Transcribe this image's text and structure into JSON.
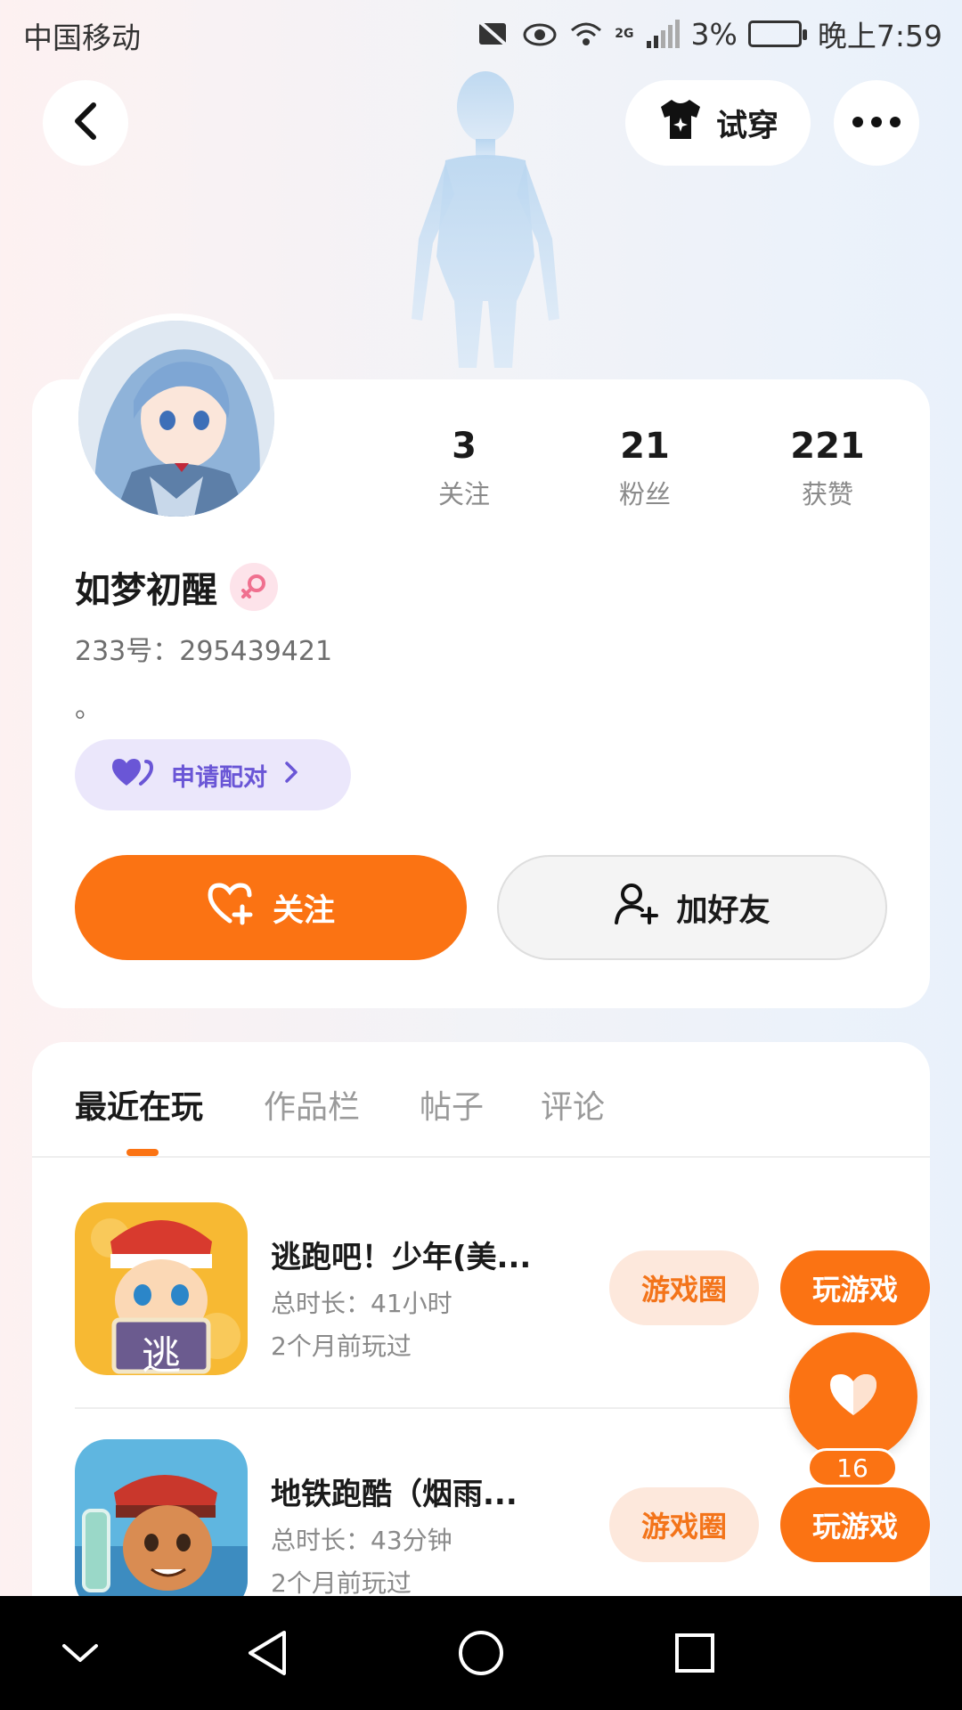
{
  "status_bar": {
    "carrier": "中国移动",
    "network": "2G",
    "battery": "3%",
    "time": "晚上7:59"
  },
  "header": {
    "try_on_label": "试穿"
  },
  "profile": {
    "stats": [
      {
        "value": "3",
        "label": "关注"
      },
      {
        "value": "21",
        "label": "粉丝"
      },
      {
        "value": "221",
        "label": "获赞"
      }
    ],
    "username": "如梦初醒",
    "user_id": "233号：295439421",
    "bio": "。",
    "pair_button": "申请配对",
    "follow_button": "关注",
    "add_friend_button": "加好友"
  },
  "tabs": [
    {
      "label": "最近在玩",
      "active": true
    },
    {
      "label": "作品栏",
      "active": false
    },
    {
      "label": "帖子",
      "active": false
    },
    {
      "label": "评论",
      "active": false
    }
  ],
  "games": [
    {
      "title": "逃跑吧！少年(美...",
      "duration": "总时长：41小时",
      "last_played": "2个月前玩过",
      "icon_text": "逃",
      "circle_button": "游戏圈",
      "play_button": "玩游戏"
    },
    {
      "title": "地铁跑酷（烟雨...",
      "duration": "总时长：43分钟",
      "last_played": "2个月前玩过",
      "circle_button": "游戏圈",
      "play_button": "玩游戏"
    }
  ],
  "like_count": "16",
  "colors": {
    "accent": "#fb7313",
    "pair_purple": "#6a56d6",
    "pair_bg": "#ebe7fb"
  }
}
